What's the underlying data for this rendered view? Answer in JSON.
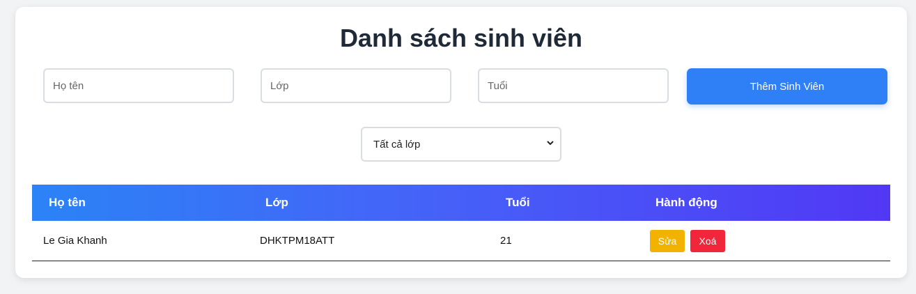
{
  "page": {
    "title": "Danh sách sinh viên"
  },
  "form": {
    "name_placeholder": "Họ tên",
    "class_placeholder": "Lớp",
    "age_placeholder": "Tuổi",
    "add_button_label": "Thêm Sinh Viên"
  },
  "filter": {
    "selected": "Tất cả lớp"
  },
  "table": {
    "headers": [
      "Họ tên",
      "Lớp",
      "Tuổi",
      "Hành động"
    ],
    "rows": [
      {
        "name": "Le Gia Khanh",
        "class": "DHKTPM18ATT",
        "age": "21",
        "edit_label": "Sửa",
        "delete_label": "Xoá"
      }
    ]
  },
  "colors": {
    "primary": "#2f80f6",
    "header_gradient_start": "#2b83f6",
    "header_gradient_end": "#5138f5",
    "edit": "#f2b300",
    "delete": "#f1263a"
  },
  "icons": {
    "filter_dropdown": "chevron-down-icon"
  }
}
